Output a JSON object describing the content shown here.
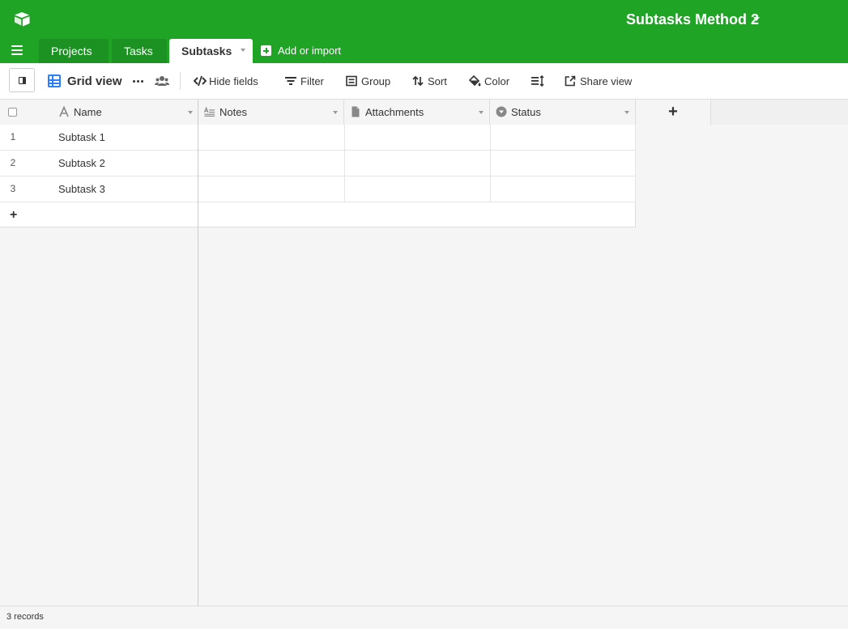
{
  "header": {
    "base_title": "Subtasks Method 2",
    "brand_color": "#20a426"
  },
  "tabs": {
    "items": [
      {
        "label": "Projects",
        "active": false
      },
      {
        "label": "Tasks",
        "active": false
      },
      {
        "label": "Subtasks",
        "active": true
      }
    ],
    "add_import_label": "Add or import"
  },
  "toolbar": {
    "view_name": "Grid view",
    "view_icon": "grid-view-icon",
    "hide_fields_label": "Hide fields",
    "filter_label": "Filter",
    "group_label": "Group",
    "sort_label": "Sort",
    "color_label": "Color",
    "share_view_label": "Share view"
  },
  "grid": {
    "columns": [
      {
        "label": "Name",
        "icon": "text-field-icon"
      },
      {
        "label": "Notes",
        "icon": "long-text-icon"
      },
      {
        "label": "Attachments",
        "icon": "attachment-icon"
      },
      {
        "label": "Status",
        "icon": "single-select-icon"
      }
    ],
    "add_column_symbol": "+",
    "rows": [
      {
        "num": "1",
        "name": "Subtask 1"
      },
      {
        "num": "2",
        "name": "Subtask 2"
      },
      {
        "num": "3",
        "name": "Subtask 3"
      }
    ],
    "add_row_symbol": "+"
  },
  "footer": {
    "record_count": "3 records"
  }
}
